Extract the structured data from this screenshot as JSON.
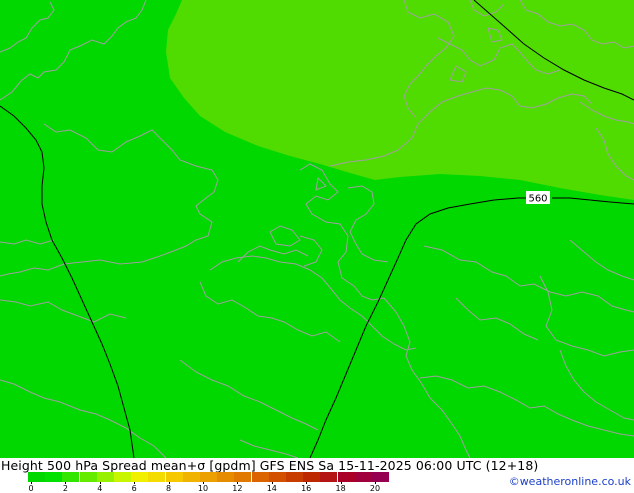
{
  "title": "Height 500 hPa Spread mean+σ [gpdm] GFS ENS Sa 15-11-2025 06:00 UTC (12+18)",
  "credit": "©weatheronline.co.uk",
  "contour_label": "560",
  "colors": {
    "field_main": "#00d800",
    "field_light": "#50dc00",
    "coastline": "#a0a0a0",
    "contour": "#000000"
  },
  "colorbar": {
    "tick_labels": [
      "0",
      "2",
      "4",
      "6",
      "8",
      "10",
      "12",
      "14",
      "16",
      "18",
      "20"
    ],
    "colors": [
      "#00d800",
      "#00e100",
      "#32e600",
      "#64eb00",
      "#96f000",
      "#c8f500",
      "#f0f000",
      "#f5dc00",
      "#f5c800",
      "#f0b400",
      "#eba000",
      "#e68c00",
      "#e17800",
      "#dc6400",
      "#d25000",
      "#c83c00",
      "#be2800",
      "#b41414",
      "#aa0028",
      "#a0003c",
      "#960050"
    ]
  }
}
